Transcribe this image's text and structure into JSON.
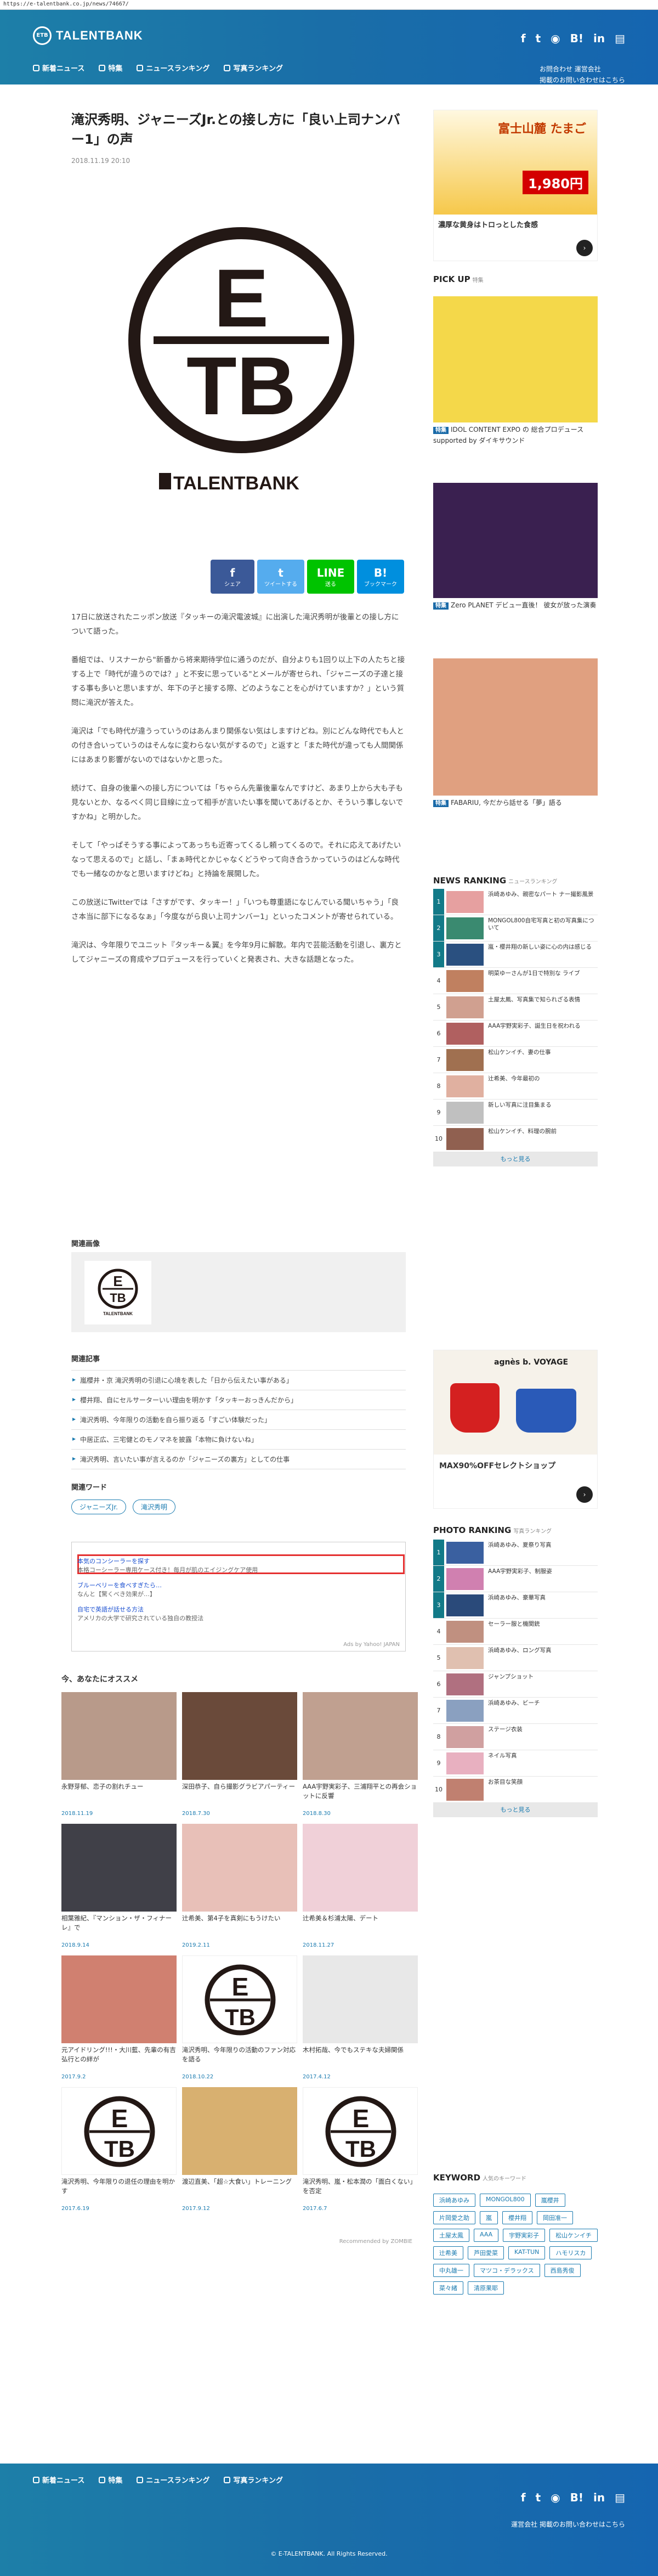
{
  "url": "https://e-talentbank.co.jp/news/74667/",
  "header": {
    "logo_mark": "ETB",
    "logo_text": "TALENTBANK",
    "nav": [
      "新着ニュース",
      "特集",
      "ニュースランキング",
      "写真ランキング"
    ],
    "social": [
      "f",
      "t",
      "◉",
      "B!",
      "in",
      "▤"
    ],
    "links": [
      "お問合わせ 運営会社",
      "掲載のお問い合わせはこちら"
    ]
  },
  "article": {
    "title": "滝沢秀明、ジャニーズJr.との接し方に「良い上司ナンバー1」の声",
    "date": "2018.11.19 20:10",
    "eyecatch_mark": "ETB",
    "eyecatch_wordmark": "TALENTBANK",
    "share": [
      {
        "icon": "f",
        "label": "シェア"
      },
      {
        "icon": "t",
        "label": "ツイートする"
      },
      {
        "icon": "LINE",
        "label": "送る"
      },
      {
        "icon": "B!",
        "label": "ブックマーク"
      }
    ],
    "paragraphs": [
      "17日に放送されたニッポン放送『タッキーの滝沢電波城』に出演した滝沢秀明が後輩との接し方について語った。",
      "番組では、リスナーから\"新番から将来期待学位に通うのだが、自分よりも1回り以上下の人たちと接する上で「時代が違うのでは？」と不安に思っている\"とメールが寄せられ、「ジャニーズの子達と接する事も多いと思いますが、年下の子と接する際、どのようなことを心がけていますか？」という質問に滝沢が答えた。",
      "滝沢は「でも時代が違うっていうのはあんまり関係ない気はしますけどね。別にどんな時代でも人との付き合いっていうのはそんなに変わらない気がするので」と返すと「また時代が違っても人間関係にはあまり影響がないのではないかと思った。",
      "続けて、自身の後輩への接し方については「ちゃらん先輩後輩なんですけど、あまり上から大も子も見ないとか、なるべく同じ目線に立って相手が言いたい事を聞いてあげるとか、そういう事しないですかね」と明かした。",
      "そして「やっぱそうする事によってあっちも近寄ってくるし頼ってくるので。それに応えてあげたいなって思えるので」と話し、「まぁ時代とかじゃなくどうやって向き合うかっていうのはどんな時代でも一緒なのかなと思いますけどね」と持論を展開した。",
      "この放送にTwitterでは「さすがです、タッキー！」「いつも尊重語になじんでいる聞いちゃう」「良さ本当に部下になるなぁ」「今度ながら良い上司ナンバー1」といったコメントが寄せられている。",
      "滝沢は、今年限りでユニット『タッキー＆翼』を今年9月に解散。年内で芸能活動を引退し、裏方としてジャニーズの育成やプロデュースを行っていくと発表され、大きな話題となった。"
    ]
  },
  "related_image": {
    "label": "関連画像"
  },
  "related_articles": {
    "label": "関連記事",
    "items": [
      "嵐櫻井・京 滝沢秀明の引退に心境を表した「日から伝えたい事がある」",
      "櫻井翔、自にセルサーターいい理由を明かす「タッキーおっきんだから」",
      "滝沢秀明、今年限りの活動を自ら振り返る「すごい体験だった」",
      "中居正広、三宅健とのモノマネを披露「本物に負けないね」",
      "滝沢秀明、言いたい事が言えるのか「ジャニーズの裏方」としての仕事"
    ]
  },
  "related_words": {
    "label": "関連ワード",
    "tags": [
      "ジャニーズJr.",
      "滝沢秀明"
    ]
  },
  "ads": {
    "lines": [
      "本気のコンシーラーを探す",
      "本格コーシーラー専用ケース付き！毎月が肌のエイジングケア使用",
      "ブルーベリーを食べすぎたら…",
      "なんと【驚くべき効果が…】",
      "自宅で英語が話せる方法",
      "アメリカの大学で研究されている独自の教授法"
    ],
    "footer": "Ads by Yahoo! JAPAN"
  },
  "recommend": {
    "title": "今、あなたにオススメ",
    "powered": "Recommended by ZOMBIE",
    "cards": [
      {
        "caption": "永野芽郁、恋子の割れチュー",
        "date": "2018.11.19",
        "color": "#b89a8a"
      },
      {
        "caption": "深田恭子、自ら撮影グラビアパーティー",
        "date": "2018.7.30",
        "color": "#6a4a3a"
      },
      {
        "caption": "AAA宇野実彩子、三浦翔平との再会ショットに反響",
        "date": "2018.8.30",
        "color": "#c0a090"
      },
      {
        "caption": "相葉雅紀、『マンション・ザ・フィナーレ』で",
        "date": "2018.9.14",
        "color": "#404048"
      },
      {
        "caption": "辻希美、第4子を真剣にもうけたい",
        "date": "2019.2.11",
        "color": "#e8c0b8"
      },
      {
        "caption": "辻希美＆杉浦太陽、デート",
        "date": "2018.11.27",
        "color": "#f0d0d8"
      },
      {
        "caption": "元アイドリング!!!・大川藍、先輩の有吉弘行との絆が",
        "date": "2017.9.2",
        "color": "#d08070"
      },
      {
        "caption": "滝沢秀明、今年限りの活動のファン対応を語る",
        "date": "2018.10.22",
        "color": "#ffffff"
      },
      {
        "caption": "木村拓哉、今でもステキな夫婦関係",
        "date": "2017.4.12",
        "color": "#e8e8e8"
      },
      {
        "caption": "滝沢秀明、今年限りの退任の理由を明かす",
        "date": "2017.6.19",
        "color": "#ffffff"
      },
      {
        "caption": "渡辺直美、「超☆大食い」トレーニング",
        "date": "2017.9.12",
        "color": "#d8b070"
      },
      {
        "caption": "滝沢秀明、嵐・松本潤の「面白くない」を否定",
        "date": "2017.6.7",
        "color": "#ffffff"
      }
    ]
  },
  "sidebar": {
    "pickup": {
      "heading": "PICK UP",
      "sub": "特集",
      "items": [
        {
          "badge": "特集",
          "caption": "IDOL CONTENT EXPO の 総合プロデュース supported by ダイキサウンド",
          "color": "#f4d84a"
        },
        {
          "badge": "特集",
          "caption": "Zero PLANET デビュー直後！ 彼女が放った演奏",
          "color": "#3a2050"
        },
        {
          "badge": "特集",
          "caption": "FABARIU, 今だから話せる「夢」語る",
          "color": "#e0a080"
        }
      ]
    },
    "news_ranking": {
      "heading": "NEWS RANKING",
      "sub": "ニュースランキング",
      "items": [
        "浜崎あゆみ、親密なパート ナー撮影風景",
        "MONGOL800自宅写真と初の写真集について",
        "嵐・櫻井翔の新しい姿に心の内は感じる",
        "明菜ゆーさんが1日で特別な ライブ",
        "土屋太鳳、写真集で知られざる表情",
        "AAA宇野実彩子、誕生日を祝われる",
        "松山ケンイチ、妻の仕事",
        "辻希美、今年最初の",
        "新しい写真に注目集まる",
        "松山ケンイチ、料理の腕前"
      ],
      "more": "もっと見る"
    },
    "photo_ranking": {
      "heading": "PHOTO RANKING",
      "sub": "写真ランキング",
      "items": [
        "浜崎あゆみ、夏祭り写真",
        "AAA宇野実彩子、制服姿",
        "浜崎あゆみ、豪華写真",
        "セーラー服と機関銃",
        "浜崎あゆみ、ロング写真",
        "ジャンプショット",
        "浜崎あゆみ、ビーチ",
        "ステージ衣装",
        "ネイル写真",
        "お茶目な笑顔"
      ],
      "more": "もっと見る"
    },
    "ad_banner_top": {
      "brand": "富士山麓 たまご",
      "price": "1,980円",
      "catch": "濃厚な黄身はトロっとした食感"
    },
    "ad_banner_mid": {
      "brand": "agnès b. VOYAGE",
      "catch": "MAX90%OFFセレクトショップ"
    },
    "keyword": {
      "heading": "KEYWORD",
      "sub": "人気のキーワード",
      "tags": [
        "浜崎あゆみ",
        "MONGOL800",
        "嵐櫻井",
        "片岡愛之助",
        "嵐",
        "櫻井翔",
        "岡田准一",
        "土屋太鳳",
        "AAA",
        "宇野実彩子",
        "松山ケンイチ",
        "辻希美",
        "芦田愛菜",
        "KAT-TUN",
        "ハモリスカ",
        "中丸雄一",
        "マツコ・デラックス",
        "西島秀俊",
        "菜々緒",
        "清原果耶"
      ]
    }
  },
  "footer": {
    "links": "運営会社 掲載のお問い合わせはこちら",
    "copyright": "© E-TALENTBANK. All Rights Reserved."
  }
}
